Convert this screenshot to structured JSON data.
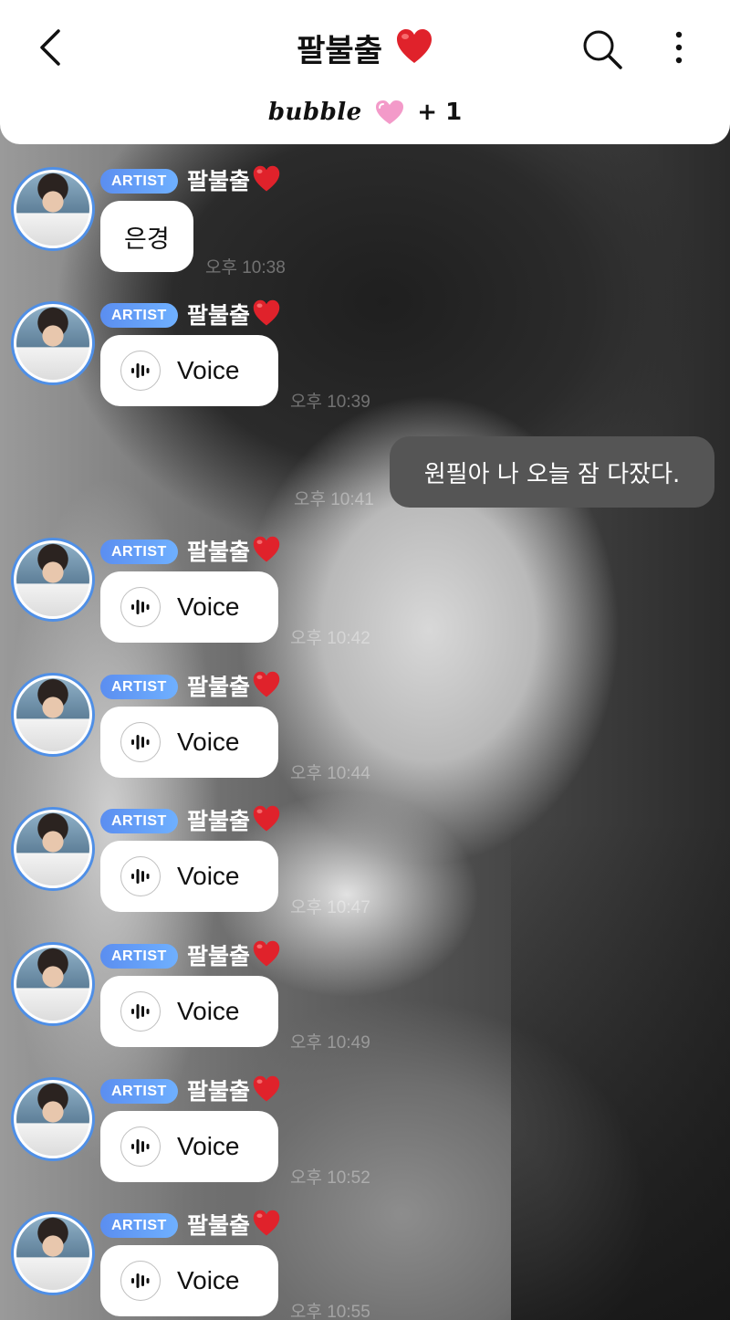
{
  "header": {
    "title": "팔불출",
    "bubble_brand": "bubble",
    "member_count": "+ 1"
  },
  "colors": {
    "badge": "#5b8ef0",
    "avatar_ring": "#4f8fe6",
    "my_bubble": "#555555"
  },
  "messages": [
    {
      "badge": "ARTIST",
      "sender": "팔불출",
      "type": "text",
      "text": "은경",
      "time": "오후 10:38"
    },
    {
      "badge": "ARTIST",
      "sender": "팔불출",
      "type": "voice",
      "text": "Voice",
      "time": "오후 10:39"
    },
    {
      "badge": "ARTIST",
      "sender": "팔불출",
      "type": "voice",
      "text": "Voice",
      "time": "오후 10:42"
    },
    {
      "badge": "ARTIST",
      "sender": "팔불출",
      "type": "voice",
      "text": "Voice",
      "time": "오후 10:44"
    },
    {
      "badge": "ARTIST",
      "sender": "팔불출",
      "type": "voice",
      "text": "Voice",
      "time": "오후 10:47"
    },
    {
      "badge": "ARTIST",
      "sender": "팔불출",
      "type": "voice",
      "text": "Voice",
      "time": "오후 10:49"
    },
    {
      "badge": "ARTIST",
      "sender": "팔불출",
      "type": "voice",
      "text": "Voice",
      "time": "오후 10:52"
    },
    {
      "badge": "ARTIST",
      "sender": "팔불출",
      "type": "voice",
      "text": "Voice",
      "time": "오후 10:55"
    }
  ],
  "my_message": {
    "text": "원필아 나 오늘 잠 다잤다.",
    "time": "오후 10:41"
  }
}
